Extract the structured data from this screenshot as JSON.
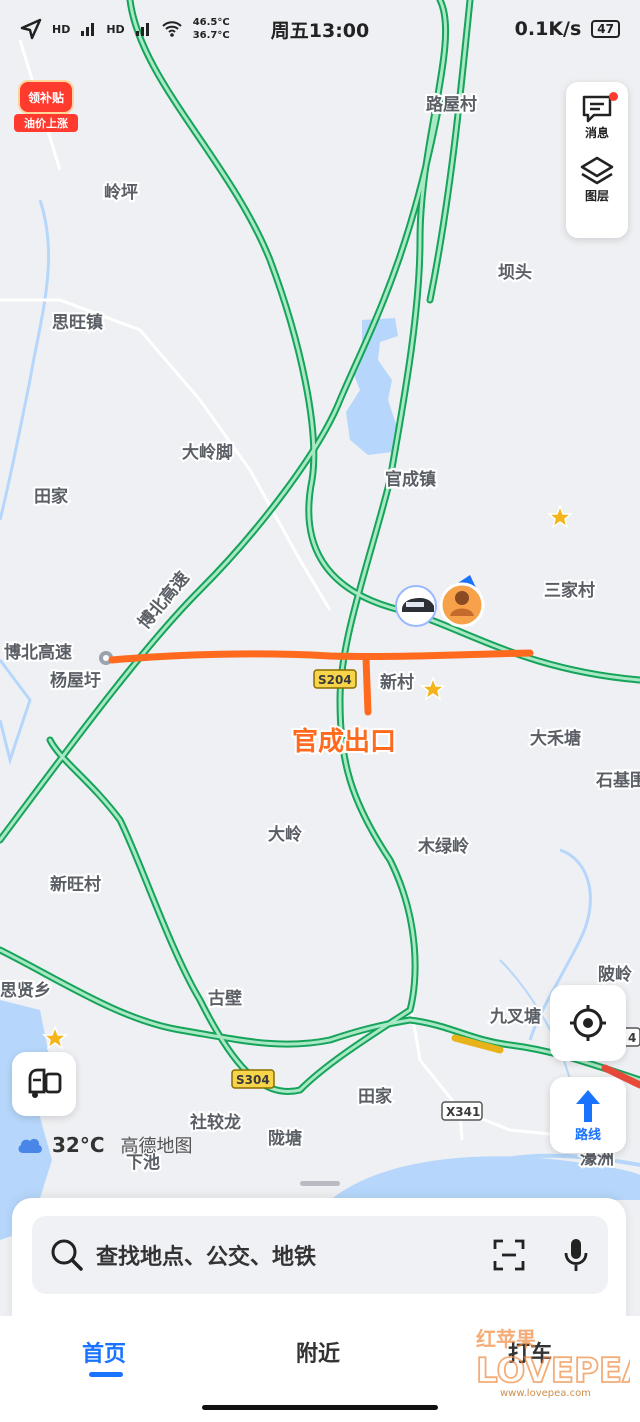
{
  "status_bar": {
    "hd_1": "HD",
    "hd_2": "HD",
    "temp_1": "46.5°C",
    "temp_2": "36.7°C",
    "time": "周五13:00",
    "net_speed": "0.1K/s",
    "battery": "47"
  },
  "promo": {
    "top": "领补贴",
    "bottom": "油价上涨"
  },
  "side_panel": {
    "messages": "消息",
    "layers": "图层"
  },
  "map_labels": {
    "luwucun": "路屋村",
    "lingping": "岭坪",
    "batou": "坝头",
    "siwangzhen": "思旺镇",
    "daling_jiao": "大岭脚",
    "tianjia_w": "田家",
    "guanchengzhen": "官成镇",
    "sanjiacun": "三家村",
    "expressway_1": "博北高速",
    "expressway_2": "博北高速",
    "yangwuxu": "杨屋圩",
    "xincun": "新村",
    "dahetang": "大禾塘",
    "shibiao": "石基围",
    "dajing": "大岭",
    "mulingling": "木绿岭",
    "xinwangcun": "新旺村",
    "simaxiang": "思贤乡",
    "gubi": "古壁",
    "jiuchatang": "九叉塘",
    "tianjia_s": "田家",
    "duling": "陂岭",
    "shezhuolong": "社较龙",
    "longtang": "陇塘",
    "xiachi": "下池",
    "haozhou": "濠洲"
  },
  "road_shields": {
    "s204": "S204",
    "s304": "S304",
    "x341": "X341",
    "edge": "4"
  },
  "annotation": "官成出口",
  "buttons": {
    "route": "路线"
  },
  "weather": {
    "temp": "32°C",
    "brand": "高德地图"
  },
  "search": {
    "placeholder": "查找地点、公交、地铁"
  },
  "tabs": [
    "首页",
    "附近",
    "打车"
  ],
  "watermark": {
    "brand": "红苹果",
    "url": "www.lovepea.com"
  },
  "colors": {
    "accent": "#1a73ff",
    "highway": "#16a35a",
    "annotation": "#ff6a1f",
    "water": "#b6d7fb"
  }
}
